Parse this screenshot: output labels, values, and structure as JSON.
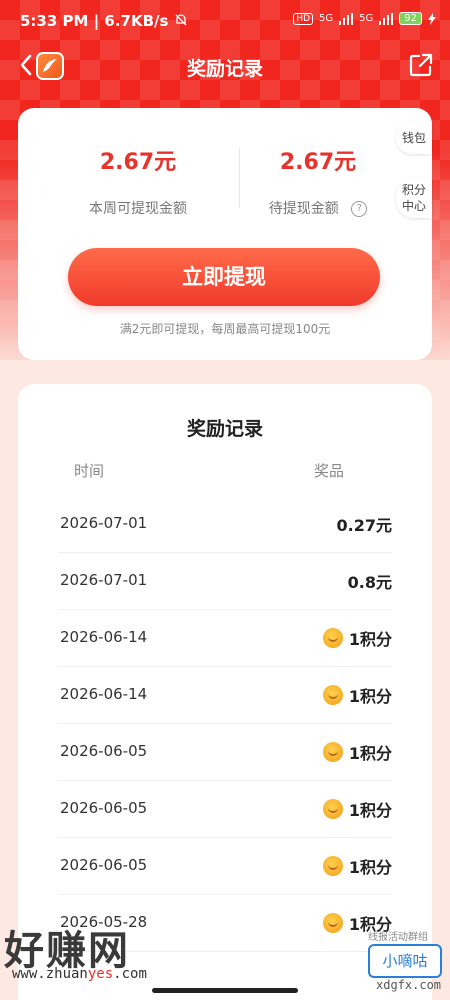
{
  "status_bar": {
    "time": "5:33 PM",
    "speed": "6.7KB/s",
    "hd": "HD",
    "network1": "5G",
    "network2": "5G",
    "battery": "92"
  },
  "nav": {
    "title": "奖励记录",
    "back_icon": "chevron-left-icon",
    "share_icon": "share-icon"
  },
  "summary": {
    "week_amount": "2.67元",
    "week_label": "本周可提现金额",
    "pending_amount": "2.67元",
    "pending_label": "待提现金额",
    "help_icon": "?",
    "withdraw_button": "立即提现",
    "tip": "满2元即可提现，每周最高可提现100元"
  },
  "side_buttons": {
    "wallet": "钱包",
    "points_line1": "积分",
    "points_line2": "中心"
  },
  "records": {
    "title": "奖励记录",
    "col_time": "时间",
    "col_prize": "奖品",
    "rows": [
      {
        "date": "2026-07-01",
        "prize": "0.27元",
        "coin": false
      },
      {
        "date": "2026-07-01",
        "prize": "0.8元",
        "coin": false
      },
      {
        "date": "2026-06-14",
        "prize": "1积分",
        "coin": true
      },
      {
        "date": "2026-06-14",
        "prize": "1积分",
        "coin": true
      },
      {
        "date": "2026-06-05",
        "prize": "1积分",
        "coin": true
      },
      {
        "date": "2026-06-05",
        "prize": "1积分",
        "coin": true
      },
      {
        "date": "2026-06-05",
        "prize": "1积分",
        "coin": true
      },
      {
        "date": "2026-05-28",
        "prize": "1积分",
        "coin": true
      }
    ]
  },
  "watermarks": {
    "left_text": "好赚网",
    "left_url_prefix": "www.zhuan",
    "left_url_accent": "yes",
    "left_url_suffix": ".com",
    "right_small": "线报活动群组",
    "right_box": "小嘀咕",
    "right_url": "xdgfx.com"
  },
  "colors": {
    "accent": "#e8322c",
    "header_red": "#f0261f",
    "page_bg": "#fde9e1"
  }
}
